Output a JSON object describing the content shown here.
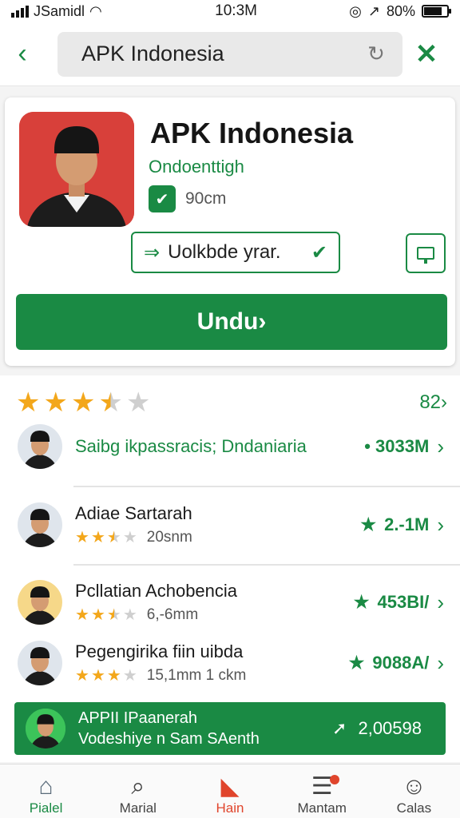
{
  "status_bar": {
    "carrier": "JSamidl",
    "time": "10:3M",
    "battery": "80%",
    "battery_level": 0.8
  },
  "top_bar": {
    "back": "‹",
    "search_value": "APK Indonesia",
    "close": "✕"
  },
  "app": {
    "title": "APK Indonesia",
    "developer": "Ondoenttigh",
    "size": "90cm",
    "verify_label": "Uolkbde yrar.",
    "install_label": "Undu›"
  },
  "rating": {
    "value": 3.5,
    "max": 5,
    "count": "82›"
  },
  "list": [
    {
      "title": "Saibg ikpassracis; Dndaniaria",
      "sub": "",
      "stars": 0,
      "right": "• 3033M",
      "green": true
    },
    {
      "title": "Adiae Sartarah",
      "sub": "20snm",
      "stars": 2.5,
      "right": "2.-1M",
      "green": false
    },
    {
      "title": "Pcllatian Achobencia",
      "sub": "6,-6mm",
      "stars": 2.5,
      "right": "453BI/",
      "green": false
    },
    {
      "title": "Pegengirika fiin uibda",
      "sub": "15,1mm 1 ckm",
      "stars": 3,
      "right": "9088A/",
      "green": false
    }
  ],
  "promo": {
    "line1": "APPII IPaanerah",
    "line2": "Vodeshiye n Sam SAenth",
    "value": "2,00598"
  },
  "nav": [
    {
      "label": "Pialel"
    },
    {
      "label": "Marial"
    },
    {
      "label": "Hain"
    },
    {
      "label": "Mantam"
    },
    {
      "label": "Calas"
    }
  ],
  "colors": {
    "accent": "#1a8a44",
    "star": "#f3a71b",
    "active_nav": "#e0452c",
    "icon_bg": "#d8403a"
  }
}
